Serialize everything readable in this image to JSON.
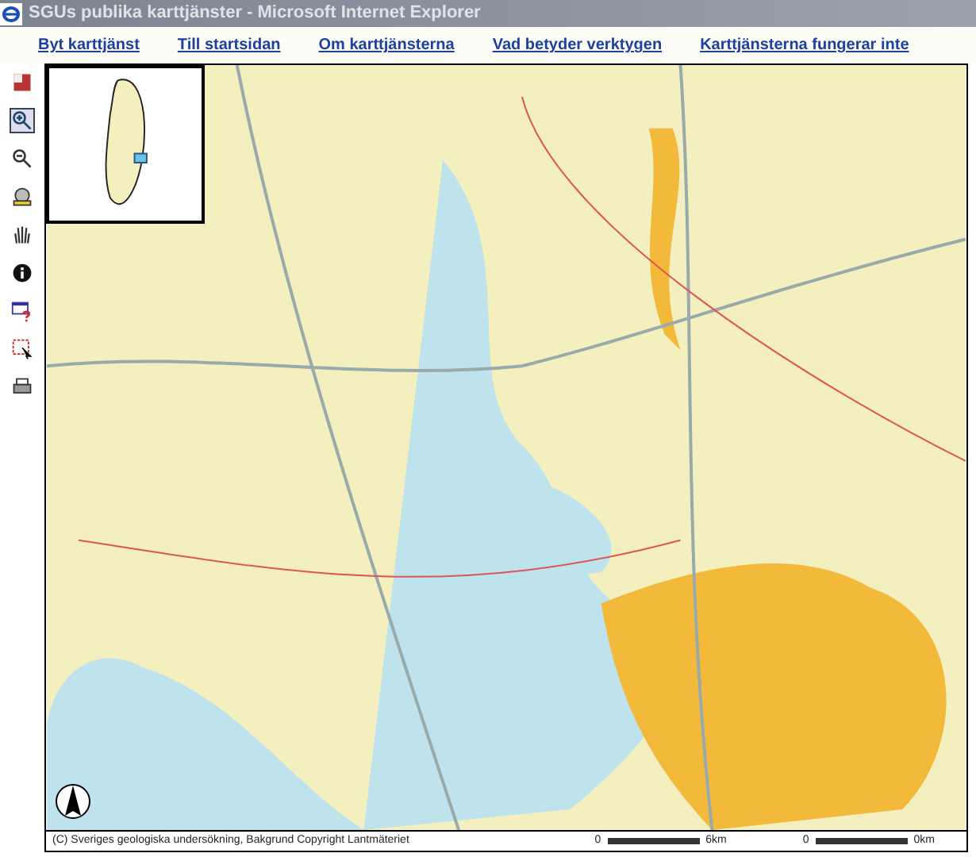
{
  "window": {
    "title": "SGUs publika karttjänster - Microsoft Internet Explorer"
  },
  "links": [
    "Byt karttjänst",
    "Till startsidan",
    "Om karttjänsterna",
    "Vad betyder verktygen",
    "Karttjänsterna fungerar inte"
  ],
  "tools": [
    {
      "kind": "legend",
      "selected": false
    },
    {
      "kind": "zoomin",
      "selected": true
    },
    {
      "kind": "zoomout",
      "selected": false
    },
    {
      "kind": "fullextent",
      "selected": false
    },
    {
      "kind": "pan",
      "selected": false
    },
    {
      "kind": "info",
      "selected": false
    },
    {
      "kind": "query",
      "selected": false
    },
    {
      "kind": "select",
      "selected": false
    },
    {
      "kind": "print",
      "selected": false
    }
  ],
  "map": {
    "copyright": "(C) Sveriges geologiska undersökning, Bakgrund Copyright Lantmäteriet",
    "scales": [
      {
        "start": "0",
        "end": "6km"
      },
      {
        "start": "0",
        "end": "0km"
      }
    ]
  }
}
